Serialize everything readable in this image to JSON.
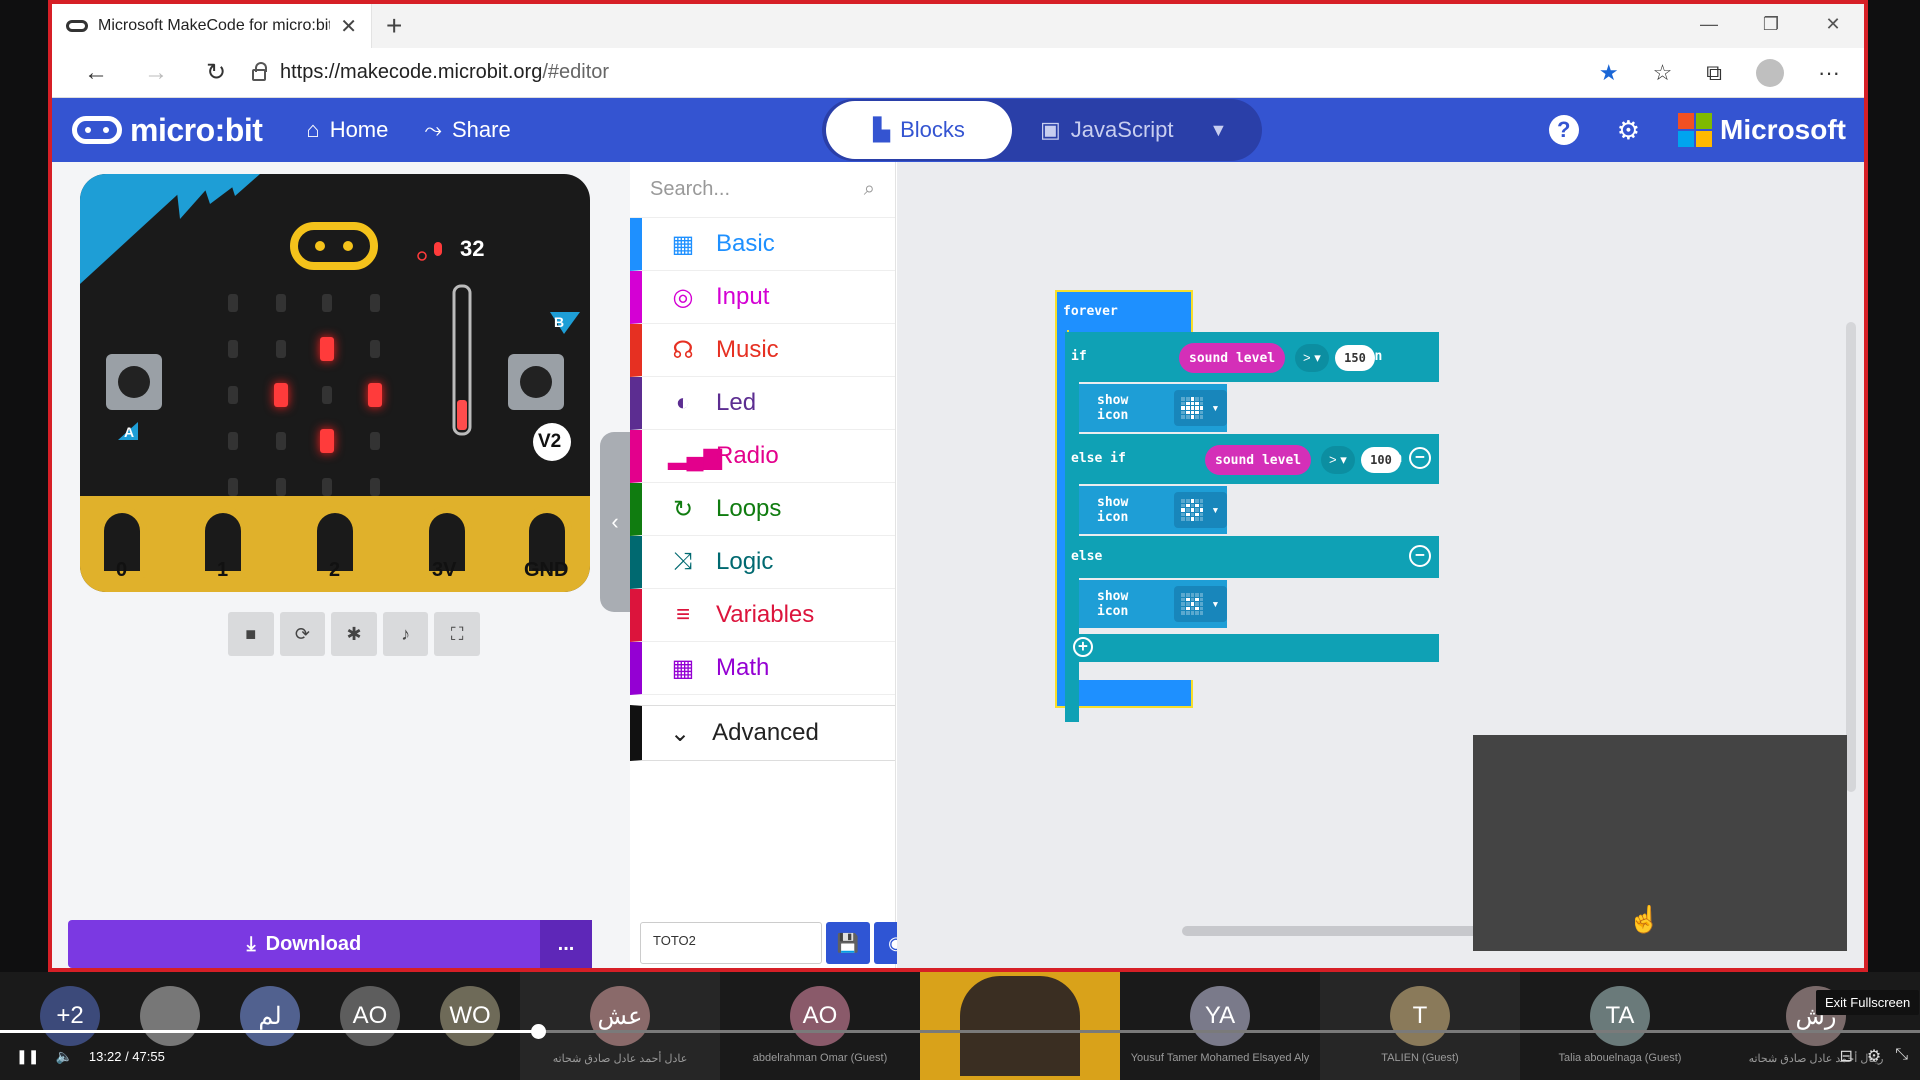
{
  "browser": {
    "tab_title": "Microsoft MakeCode for micro:bit",
    "url_host": "https://makecode.microbit.org",
    "url_path": "/#editor"
  },
  "header": {
    "logo": "micro:bit",
    "home": "Home",
    "share": "Share",
    "blocks": "Blocks",
    "javascript": "JavaScript",
    "brand": "Microsoft"
  },
  "simulator": {
    "sound_level": "32",
    "version": "V2",
    "button_a": "A",
    "button_b": "B",
    "pins": [
      "0",
      "1",
      "2",
      "3V",
      "GND"
    ],
    "download": "Download",
    "more": "..."
  },
  "toolbox": {
    "search_placeholder": "Search...",
    "categories": [
      {
        "label": "Basic",
        "color": "#1e90ff"
      },
      {
        "label": "Input",
        "color": "#d400d4"
      },
      {
        "label": "Music",
        "color": "#e63022"
      },
      {
        "label": "Led",
        "color": "#5c2d91"
      },
      {
        "label": "Radio",
        "color": "#e3008c"
      },
      {
        "label": "Loops",
        "color": "#107c10"
      },
      {
        "label": "Logic",
        "color": "#006970"
      },
      {
        "label": "Variables",
        "color": "#dc143c"
      },
      {
        "label": "Math",
        "color": "#9400d3"
      }
    ],
    "advanced": "Advanced"
  },
  "project": {
    "name": "TOTO2"
  },
  "blocks": {
    "forever": "forever",
    "if": "if",
    "else_if": "else if",
    "else": "else",
    "then": "then",
    "sound_level": "sound level",
    "operator": "> ▾",
    "value_1": "150",
    "value_2": "100",
    "show_icon": "show icon"
  },
  "meeting": {
    "participants": [
      {
        "initials": "+2",
        "name": ""
      },
      {
        "initials": "",
        "name": ""
      },
      {
        "initials": "لم",
        "name": ""
      },
      {
        "initials": "AO",
        "name": ""
      },
      {
        "initials": "WO",
        "name": ""
      },
      {
        "initials": "عش",
        "name": "عادل أحمد عادل صادق شحاته"
      },
      {
        "initials": "AO",
        "name": "abdelrahman Omar (Guest)"
      },
      {
        "initials": "",
        "name": ""
      },
      {
        "initials": "YA",
        "name": "Yousuf Tamer Mohamed Elsayed Aly"
      },
      {
        "initials": "T",
        "name": "TALIEN (Guest)"
      },
      {
        "initials": "TA",
        "name": "Talia abouelnaga (Guest)"
      },
      {
        "initials": "رش",
        "name": "ريتال أحمد عادل صادق شحاته"
      }
    ],
    "time_current": "13:22",
    "time_total": "47:55",
    "progress": 0.28,
    "exit_fullscreen": "Exit Fullscreen"
  },
  "colors": {
    "header": "#3454d1",
    "download": "#7b39e2",
    "forever": "#1e90ff",
    "logic": "#0fa1b5",
    "input_pill": "#d42fb8",
    "border": "#d61f26"
  }
}
